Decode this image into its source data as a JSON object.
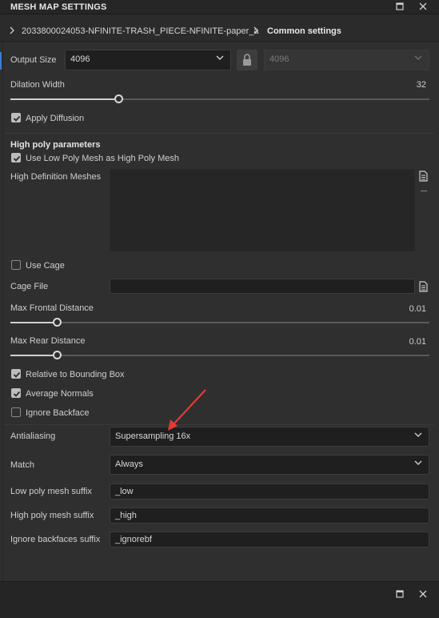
{
  "titlebar": {
    "title": "MESH MAP SETTINGS"
  },
  "breadcrumb": {
    "items": [
      "2033800024053-NFINITE-TRASH_PIECE-NFINITE-paper_a",
      "Common settings"
    ]
  },
  "output_size": {
    "label": "Output Size",
    "value": "4096",
    "locked_value": "4096"
  },
  "dilation": {
    "label": "Dilation Width",
    "value": "32",
    "fraction": 0.26
  },
  "apply_diffusion": {
    "label": "Apply Diffusion",
    "checked": true
  },
  "high_poly": {
    "title": "High poly parameters",
    "use_low_poly": {
      "label": "Use Low Poly Mesh as High Poly Mesh",
      "checked": true
    },
    "hd_meshes_label": "High Definition Meshes"
  },
  "use_cage": {
    "label": "Use Cage",
    "checked": false
  },
  "cage_file": {
    "label": "Cage File",
    "value": ""
  },
  "max_frontal": {
    "label": "Max Frontal Distance",
    "value": "0.01",
    "fraction": 0.11
  },
  "max_rear": {
    "label": "Max Rear Distance",
    "value": "0.01",
    "fraction": 0.11
  },
  "relative_bbox": {
    "label": "Relative to Bounding Box",
    "checked": true
  },
  "average_normals": {
    "label": "Average Normals",
    "checked": true
  },
  "ignore_backface": {
    "label": "Ignore Backface",
    "checked": false
  },
  "antialiasing": {
    "label": "Antialiasing",
    "value": "Supersampling 16x"
  },
  "match": {
    "label": "Match",
    "value": "Always"
  },
  "low_suffix": {
    "label": "Low poly mesh suffix",
    "value": "_low"
  },
  "high_suffix": {
    "label": "High poly mesh suffix",
    "value": "_high"
  },
  "ignorebf_suffix": {
    "label": "Ignore backfaces suffix",
    "value": "_ignorebf"
  },
  "colors": {
    "annotation_arrow": "#e53935",
    "accent": "#3b7bd4"
  },
  "icons": [
    "maximize-icon",
    "close-icon",
    "chevron-right-icon",
    "chevron-down-icon",
    "lock-icon",
    "file-icon",
    "checkmark-icon",
    "annotation-arrow"
  ]
}
